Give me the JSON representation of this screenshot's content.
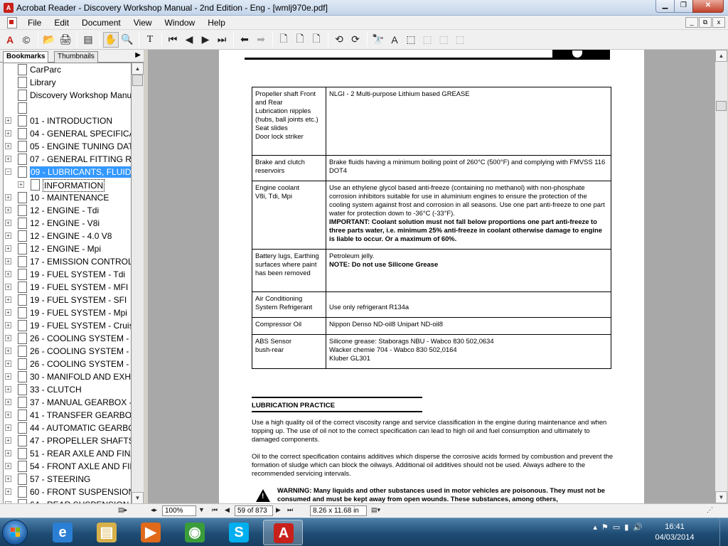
{
  "window": {
    "title": "Acrobat Reader - Discovery Workshop Manual - 2nd Edition - Eng - [wmlj970e.pdf]",
    "min": "▁",
    "max": "❐",
    "close": "✕"
  },
  "menubar": {
    "items": [
      "File",
      "Edit",
      "Document",
      "View",
      "Window",
      "Help"
    ],
    "mdi": [
      "_",
      "⧉",
      "x"
    ]
  },
  "toolbar": {
    "icons": [
      "A",
      "©",
      "📂",
      "🖨",
      "▤",
      "✋",
      "🔍",
      "T",
      "⏮",
      "◀",
      "▶",
      "⏭",
      "⬅",
      "➡",
      "🗋",
      "🗋",
      "🗋",
      "⟲",
      "⟳",
      "🔭",
      "A",
      "⬚",
      "⬚",
      "⬚",
      "⬚"
    ]
  },
  "navpane": {
    "tabs": [
      "Bookmarks",
      "Thumbnails"
    ],
    "arrow": "▶",
    "bookmarks": [
      {
        "label": "CarParc",
        "exp": "",
        "indent": 0
      },
      {
        "label": "Library",
        "exp": "",
        "indent": 0
      },
      {
        "label": "Discovery Workshop Manu",
        "exp": "",
        "indent": 0
      },
      {
        "label": "",
        "exp": "",
        "indent": 0
      },
      {
        "label": "01 - INTRODUCTION",
        "exp": "+",
        "indent": 0
      },
      {
        "label": "04 - GENERAL SPECIFICA",
        "exp": "+",
        "indent": 0
      },
      {
        "label": "05 - ENGINE TUNING DAT",
        "exp": "+",
        "indent": 0
      },
      {
        "label": "07 - GENERAL FITTING R",
        "exp": "+",
        "indent": 0
      },
      {
        "label": "09 - LUBRICANTS, FLUIDS",
        "exp": "−",
        "indent": 0,
        "selected": true
      },
      {
        "label": "INFORMATION",
        "exp": "+",
        "indent": 1,
        "focus": true
      },
      {
        "label": "10 - MAINTENANCE",
        "exp": "+",
        "indent": 0
      },
      {
        "label": "12 - ENGINE - Tdi",
        "exp": "+",
        "indent": 0
      },
      {
        "label": "12 - ENGINE - V8i",
        "exp": "+",
        "indent": 0
      },
      {
        "label": "12 - ENGINE - 4.0 V8",
        "exp": "+",
        "indent": 0
      },
      {
        "label": "12 - ENGINE - Mpi",
        "exp": "+",
        "indent": 0
      },
      {
        "label": "17 - EMISSION CONTROL",
        "exp": "+",
        "indent": 0
      },
      {
        "label": "19 - FUEL SYSTEM - Tdi",
        "exp": "+",
        "indent": 0
      },
      {
        "label": "19 - FUEL SYSTEM - MFI",
        "exp": "+",
        "indent": 0
      },
      {
        "label": "19 - FUEL SYSTEM - SFI",
        "exp": "+",
        "indent": 0
      },
      {
        "label": "19 - FUEL SYSTEM - Mpi",
        "exp": "+",
        "indent": 0
      },
      {
        "label": "19 - FUEL SYSTEM - Cruis",
        "exp": "+",
        "indent": 0
      },
      {
        "label": "26 - COOLING SYSTEM - T",
        "exp": "+",
        "indent": 0
      },
      {
        "label": "26 - COOLING SYSTEM - V",
        "exp": "+",
        "indent": 0
      },
      {
        "label": "26 - COOLING SYSTEM - M",
        "exp": "+",
        "indent": 0
      },
      {
        "label": "30 - MANIFOLD AND EXHA",
        "exp": "+",
        "indent": 0
      },
      {
        "label": "33 - CLUTCH",
        "exp": "+",
        "indent": 0
      },
      {
        "label": "37 - MANUAL GEARBOX -",
        "exp": "+",
        "indent": 0
      },
      {
        "label": "41 - TRANSFER GEARBOX",
        "exp": "+",
        "indent": 0
      },
      {
        "label": "44 - AUTOMATIC GEARBO",
        "exp": "+",
        "indent": 0
      },
      {
        "label": "47 - PROPELLER SHAFTS",
        "exp": "+",
        "indent": 0
      },
      {
        "label": "51 - REAR AXLE AND FINA",
        "exp": "+",
        "indent": 0
      },
      {
        "label": "54 - FRONT AXLE AND FIN",
        "exp": "+",
        "indent": 0
      },
      {
        "label": "57 - STEERING",
        "exp": "+",
        "indent": 0
      },
      {
        "label": "60 - FRONT SUSPENSION",
        "exp": "+",
        "indent": 0
      },
      {
        "label": "64 - REAR SUSPENSION",
        "exp": "+",
        "indent": 0
      }
    ]
  },
  "document": {
    "rows": [
      {
        "item": "Propeller shaft Front and Rear\nLubrication nipples (hubs, ball joints etc.)\nSeat slides\nDoor lock striker",
        "spec": "NLGI - 2 Multi-purpose Lithium based GREASE"
      },
      {
        "item": "Brake and clutch reservoirs",
        "spec": "Brake fluids having a minimum boiling point of 260°C (500°F) and complying with FMVSS 116 DOT4"
      },
      {
        "item": "Engine coolant\nV8i, Tdi, Mpi",
        "spec": "Use an ethylene glycol based anti-freeze (containing no methanol) with non-phosphate corrosion inhibitors suitable for use in aluminium engines to ensure the protection of the cooling system against frost and corrosion in all seasons. Use one part anti-freeze to one part water for protection down to -36°C (-33°F).",
        "spec_bold": "IMPORTANT: Coolant solution must not fall below proportions one part anti-freeze to three parts water, i.e. minimum 25% anti-freeze in coolant otherwise damage to engine is liable to occur. Or a maximum of 60%."
      },
      {
        "item": "Battery lugs, Earthing surfaces where paint has been removed",
        "spec": "Petroleum jelly.",
        "spec_bold": "NOTE: Do not use Silicone Grease"
      },
      {
        "item": "Air Conditioning System Refrigerant",
        "spec": "\nUse only refrigerant R134a"
      },
      {
        "item": "Compressor Oil",
        "spec": "Nippon Denso ND-oil8      Unipart ND-oil8"
      },
      {
        "item": "ABS Sensor\nbush-rear",
        "spec": "Silicone grease: Staborags NBU - Wabco 830 502,0634\nWacker chemie 704 - Wabco 830 502,0164\nKluber GL301"
      }
    ],
    "section_title": "LUBRICATION PRACTICE",
    "para1": "Use a high quality oil of the correct viscosity range and service classification in the engine during maintenance and when topping up. The use of oil not to the correct specification can lead to high oil and fuel consumption and ultimately to damaged components.",
    "para2": "Oil to the correct specification contains additives which disperse the corrosive acids formed by combustion and prevent the formation of sludge which can block the oilways. Additional oil additives should not be used. Always adhere to the recommended servicing intervals.",
    "warning": "WARNING: Many liquids and other substances used in motor vehicles are poisonous. They must not be consumed and must be kept away from open wounds. These substances, among others,",
    "warning_icon": "!"
  },
  "statusbar": {
    "zoom": "100%",
    "page": "59 of 873",
    "size": "8.26 x 11.68 in"
  },
  "taskbar": {
    "apps": [
      {
        "name": "internet-explorer",
        "glyph": "e",
        "color": "#2a7fd4"
      },
      {
        "name": "file-explorer",
        "glyph": "▤",
        "color": "#d8b04a"
      },
      {
        "name": "media-player",
        "glyph": "▶",
        "color": "#e06a1a"
      },
      {
        "name": "chrome",
        "glyph": "◉",
        "color": "#3a9d3a"
      },
      {
        "name": "skype",
        "glyph": "S",
        "color": "#00aff0"
      },
      {
        "name": "acrobat-reader",
        "glyph": "A",
        "color": "#c8201a",
        "active": true
      }
    ],
    "time": "16:41",
    "date": "04/03/2014"
  }
}
